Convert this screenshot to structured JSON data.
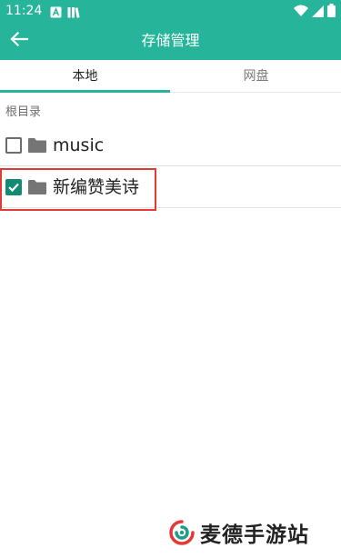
{
  "status_bar": {
    "time": "11:24",
    "icons_left": [
      "notification-a-icon",
      "notification-books-icon"
    ],
    "icons_right": [
      "wifi-icon",
      "signal-icon",
      "battery-icon"
    ]
  },
  "app_bar": {
    "back_icon": "arrow-left-icon",
    "title": "存储管理"
  },
  "tabs": [
    {
      "label": "本地",
      "selected": true
    },
    {
      "label": "网盘",
      "selected": false
    }
  ],
  "breadcrumb": "根目录",
  "items": [
    {
      "label": "music",
      "checked": false,
      "icon": "folder-icon"
    },
    {
      "label": "新编赞美诗",
      "checked": true,
      "icon": "folder-icon"
    }
  ],
  "watermark": {
    "text": "麦德手游站"
  },
  "colors": {
    "primary": "#26b59a",
    "checkbox_checked": "#138a73",
    "highlight": "#e53935"
  }
}
